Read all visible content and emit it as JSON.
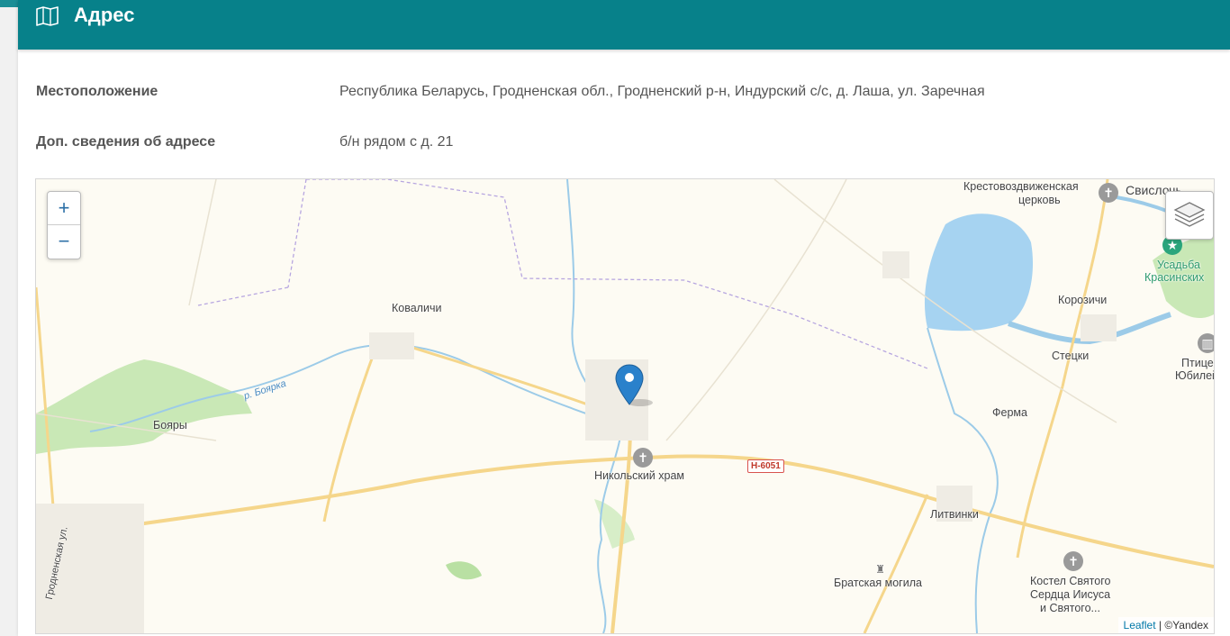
{
  "header": {
    "title": "Адрес",
    "icon": "map-icon"
  },
  "fields": [
    {
      "label": "Местоположение",
      "value": "Республика Беларусь, Гродненская обл., Гродненский р-н, Индурский с/с, д. Лаша, ул. Заречная"
    },
    {
      "label": "Доп. сведения об адресе",
      "value": "б/н рядом с д. 21"
    }
  ],
  "map": {
    "zoom_in": "+",
    "zoom_out": "−",
    "layers_icon": "layers-icon",
    "marker_icon": "location-pin-icon",
    "road_badge": "Н-6051",
    "attribution_link": "Leaflet",
    "attribution_sep": " | ",
    "attribution_text": "©Yandex",
    "labels": {
      "kovalichi": "Коваличи",
      "river": "р. Боярка",
      "boyary": "Бояры",
      "church": "Никольский храм",
      "krestovozdv1": "Крестовоздвиженская",
      "krestovozdv2": "церковь",
      "svisloch": "Свислочь",
      "usadba1": "Усадьба",
      "usadba2": "Красинских",
      "korozichi": "Корозичи",
      "stetski": "Стецки",
      "ptitsefab1": "Птицефаб",
      "ptitsefab2": "Юбилейн",
      "ferma": "Ферма",
      "litvinki": "Литвинки",
      "bratskaya": "Братская могила",
      "kostel1": "Костел Святого",
      "kostel2": "Сердца Иисуса",
      "kostel3": "и Святого...",
      "grodnenskaya": "Гродненская ул."
    },
    "colors": {
      "land": "#fdfbf3",
      "water": "#a6d3f1",
      "green": "#bfe3a9",
      "road_major": "#f7d98b",
      "road_minor": "#ffffff",
      "border": "#b7a6e0",
      "marker": "#2a81cb"
    }
  }
}
